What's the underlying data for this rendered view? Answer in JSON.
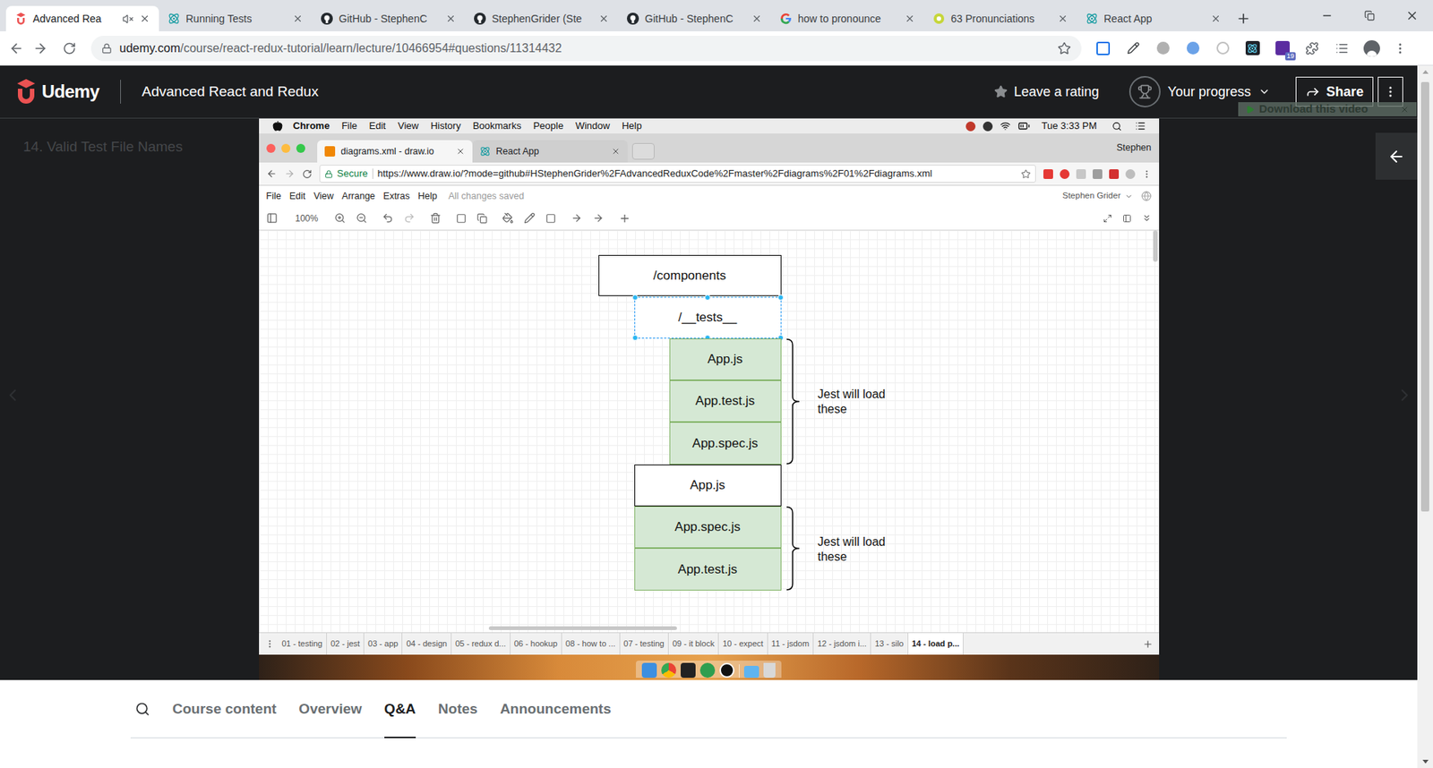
{
  "browser": {
    "tabs": [
      {
        "label": "Advanced Rea",
        "selected": true,
        "muted": true
      },
      {
        "label": "Running Tests",
        "selected": false,
        "muted": false
      },
      {
        "label": "GitHub - StephenC",
        "selected": false,
        "muted": false
      },
      {
        "label": "StephenGrider (Ste",
        "selected": false,
        "muted": false
      },
      {
        "label": "GitHub - StephenC",
        "selected": false,
        "muted": false
      },
      {
        "label": "how to pronounce",
        "selected": false,
        "muted": false
      },
      {
        "label": "63 Pronunciations",
        "selected": false,
        "muted": false
      },
      {
        "label": "React App",
        "selected": false,
        "muted": false
      }
    ],
    "url_host": "udemy.com",
    "url_path": "/course/react-redux-tutorial/learn/lecture/10466954#questions/11314432",
    "extension_badge": "19"
  },
  "header": {
    "logo": "Udemy",
    "course_title": "Advanced React and Redux",
    "rating_button": "Leave a rating",
    "progress_button": "Your progress",
    "share_button": "Share",
    "download_overlay": "Download this video"
  },
  "player": {
    "lecture_title": "14. Valid Test File Names",
    "recording": {
      "mac_menu": {
        "app": "Chrome",
        "items": [
          "File",
          "Edit",
          "View",
          "History",
          "Bookmarks",
          "People",
          "Window",
          "Help"
        ],
        "clock": "Tue 3:33 PM"
      },
      "chrome_tabs": [
        {
          "label": "diagrams.xml - draw.io",
          "selected": true
        },
        {
          "label": "React App",
          "selected": false
        }
      ],
      "chrome_profile": "Stephen",
      "secure_label": "Secure",
      "url": "https://www.draw.io/?mode=github#HStephenGrider%2FAdvancedReduxCode%2Fmaster%2Fdiagrams%2F01%2Fdiagrams.xml",
      "drawio_menu": [
        "File",
        "Edit",
        "View",
        "Arrange",
        "Extras",
        "Help"
      ],
      "save_status": "All changes saved",
      "user": "Stephen Grider",
      "zoom": "100%",
      "nodes": [
        {
          "label": "/components",
          "selected": false,
          "fill": "#ffffff",
          "border": "#000000"
        },
        {
          "label": "/__tests__",
          "selected": true,
          "fill": "#ffffff",
          "border": "#000000"
        },
        {
          "label": "App.js",
          "selected": false,
          "fill": "#d5e8d4",
          "border": "#82b366"
        },
        {
          "label": "App.test.js",
          "selected": false,
          "fill": "#d5e8d4",
          "border": "#82b366"
        },
        {
          "label": "App.spec.js",
          "selected": false,
          "fill": "#d5e8d4",
          "border": "#82b366"
        },
        {
          "label": "App.js",
          "selected": false,
          "fill": "#ffffff",
          "border": "#000000"
        },
        {
          "label": "App.spec.js",
          "selected": false,
          "fill": "#d5e8d4",
          "border": "#82b366"
        },
        {
          "label": "App.test.js",
          "selected": false,
          "fill": "#d5e8d4",
          "border": "#82b366"
        }
      ],
      "annotations": [
        {
          "label": "Jest will load these"
        },
        {
          "label": "Jest will load these"
        }
      ],
      "pages": [
        {
          "label": "01 - testing",
          "selected": false
        },
        {
          "label": "02 - jest",
          "selected": false
        },
        {
          "label": "03 - app",
          "selected": false
        },
        {
          "label": "04 - design",
          "selected": false
        },
        {
          "label": "05 - redux d...",
          "selected": false
        },
        {
          "label": "06 - hookup",
          "selected": false
        },
        {
          "label": "08 - how to ...",
          "selected": false
        },
        {
          "label": "07 - testing",
          "selected": false
        },
        {
          "label": "09 - it block",
          "selected": false
        },
        {
          "label": "10 - expect",
          "selected": false
        },
        {
          "label": "11 - jsdom",
          "selected": false
        },
        {
          "label": "12 - jsdom i...",
          "selected": false
        },
        {
          "label": "13 - silo",
          "selected": false
        },
        {
          "label": "14 - load p...",
          "selected": true
        }
      ]
    }
  },
  "bottom_tabs": [
    {
      "label": "Course content",
      "selected": false
    },
    {
      "label": "Overview",
      "selected": false
    },
    {
      "label": "Q&A",
      "selected": true
    },
    {
      "label": "Notes",
      "selected": false
    },
    {
      "label": "Announcements",
      "selected": false
    }
  ]
}
